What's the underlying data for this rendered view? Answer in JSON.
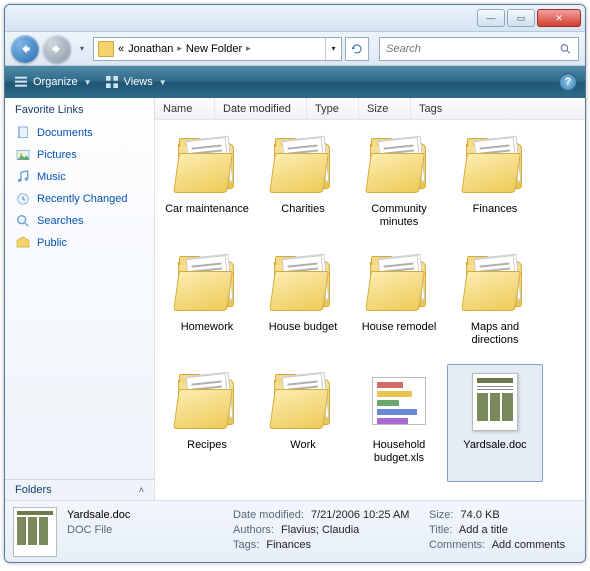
{
  "titlebar": {
    "minimize_glyph": "—",
    "maximize_glyph": "▭",
    "close_glyph": "✕"
  },
  "nav": {
    "chevrons": "«",
    "crumb1": "Jonathan",
    "crumb2": "New Folder",
    "sep": "▸",
    "dropdown": "▾"
  },
  "search": {
    "placeholder": "Search"
  },
  "toolbar": {
    "organize": "Organize",
    "views": "Views"
  },
  "sidebar": {
    "header": "Favorite Links",
    "items": [
      {
        "label": "Documents",
        "icon": "documents-icon"
      },
      {
        "label": "Pictures",
        "icon": "pictures-icon"
      },
      {
        "label": "Music",
        "icon": "music-icon"
      },
      {
        "label": "Recently Changed",
        "icon": "recent-icon"
      },
      {
        "label": "Searches",
        "icon": "searches-icon"
      },
      {
        "label": "Public",
        "icon": "public-icon"
      }
    ],
    "folders": "Folders"
  },
  "columns": {
    "name": "Name",
    "date": "Date modified",
    "type": "Type",
    "size": "Size",
    "tags": "Tags"
  },
  "items": [
    {
      "label": "Car maintenance",
      "kind": "folder"
    },
    {
      "label": "Charities",
      "kind": "folder"
    },
    {
      "label": "Community minutes",
      "kind": "folder"
    },
    {
      "label": "Finances",
      "kind": "folder"
    },
    {
      "label": "Homework",
      "kind": "folder"
    },
    {
      "label": "House budget",
      "kind": "folder"
    },
    {
      "label": "House remodel",
      "kind": "folder"
    },
    {
      "label": "Maps and directions",
      "kind": "folder"
    },
    {
      "label": "Recipes",
      "kind": "folder"
    },
    {
      "label": "Work",
      "kind": "folder"
    },
    {
      "label": "Household budget.xls",
      "kind": "xls"
    },
    {
      "label": "Yardsale.doc",
      "kind": "doc",
      "selected": true
    }
  ],
  "details": {
    "filename": "Yardsale.doc",
    "filetype": "DOC File",
    "date_modified_label": "Date modified:",
    "date_modified": "7/21/2006 10:25 AM",
    "authors_label": "Authors:",
    "authors": "Flavius; Claudia",
    "tags_label": "Tags:",
    "tags": "Finances",
    "size_label": "Size:",
    "size": "74.0 KB",
    "title_label": "Title:",
    "title": "Add a title",
    "comments_label": "Comments:",
    "comments": "Add comments"
  }
}
